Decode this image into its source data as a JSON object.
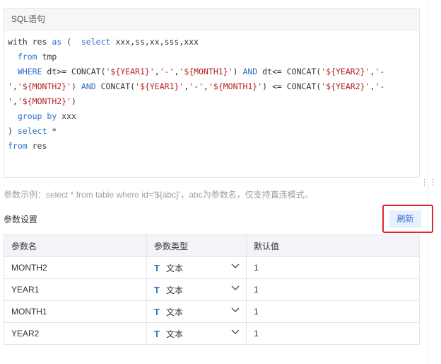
{
  "sql_panel": {
    "title": "SQL语句",
    "lines": [
      [
        {
          "t": "with res "
        },
        {
          "t": "as",
          "k": "kw"
        },
        {
          "t": " (  "
        },
        {
          "t": "select",
          "k": "kw"
        },
        {
          "t": " xxx,ss,xx,sss,xxx"
        }
      ],
      [
        {
          "t": "  "
        },
        {
          "t": "from",
          "k": "kw"
        },
        {
          "t": " tmp"
        }
      ],
      [
        {
          "t": "  "
        },
        {
          "t": "WHERE",
          "k": "kw"
        },
        {
          "t": " dt>= CONCAT("
        },
        {
          "t": "'${YEAR1}'",
          "k": "str"
        },
        {
          "t": ","
        },
        {
          "t": "'-'",
          "k": "str"
        },
        {
          "t": ","
        },
        {
          "t": "'${MONTH1}'",
          "k": "str"
        },
        {
          "t": ") "
        },
        {
          "t": "AND",
          "k": "kw"
        },
        {
          "t": " dt<= CONCAT("
        },
        {
          "t": "'${YEAR2}'",
          "k": "str"
        },
        {
          "t": ","
        },
        {
          "t": "'-",
          "k": "str"
        }
      ],
      [
        {
          "t": "'",
          "k": "str"
        },
        {
          "t": ","
        },
        {
          "t": "'${MONTH2}'",
          "k": "str"
        },
        {
          "t": ") "
        },
        {
          "t": "AND",
          "k": "kw"
        },
        {
          "t": " CONCAT("
        },
        {
          "t": "'${YEAR1}'",
          "k": "str"
        },
        {
          "t": ","
        },
        {
          "t": "'-'",
          "k": "str"
        },
        {
          "t": ","
        },
        {
          "t": "'${MONTH1}'",
          "k": "str"
        },
        {
          "t": ") <= CONCAT("
        },
        {
          "t": "'${YEAR2}'",
          "k": "str"
        },
        {
          "t": ","
        },
        {
          "t": "'-",
          "k": "str"
        }
      ],
      [
        {
          "t": "'",
          "k": "str"
        },
        {
          "t": ","
        },
        {
          "t": "'${MONTH2}'",
          "k": "str"
        },
        {
          "t": ")"
        }
      ],
      [
        {
          "t": "  "
        },
        {
          "t": "group by",
          "k": "kw"
        },
        {
          "t": " xxx"
        }
      ],
      [
        {
          "t": ") "
        },
        {
          "t": "select",
          "k": "kw"
        },
        {
          "t": " *"
        }
      ],
      [
        {
          "t": "from",
          "k": "kw"
        },
        {
          "t": " res"
        }
      ]
    ]
  },
  "hint": "参数示例：select * from table where id='${abc}'，abc为参数名，仅支持直连模式。",
  "params": {
    "title": "参数设置",
    "refresh_label": "刷新",
    "columns": [
      "参数名",
      "参数类型",
      "默认值"
    ],
    "rows": [
      {
        "name": "MONTH2",
        "type": "文本",
        "default": "1"
      },
      {
        "name": "YEAR1",
        "type": "文本",
        "default": "1"
      },
      {
        "name": "MONTH1",
        "type": "文本",
        "default": "1"
      },
      {
        "name": "YEAR2",
        "type": "文本",
        "default": "1"
      }
    ],
    "type_icon": "text-type-icon",
    "dropdown_icon": "chevron-down-icon"
  },
  "colors": {
    "accent": "#2f6fce",
    "highlight_border": "#e0242a",
    "string": "#b52020"
  }
}
